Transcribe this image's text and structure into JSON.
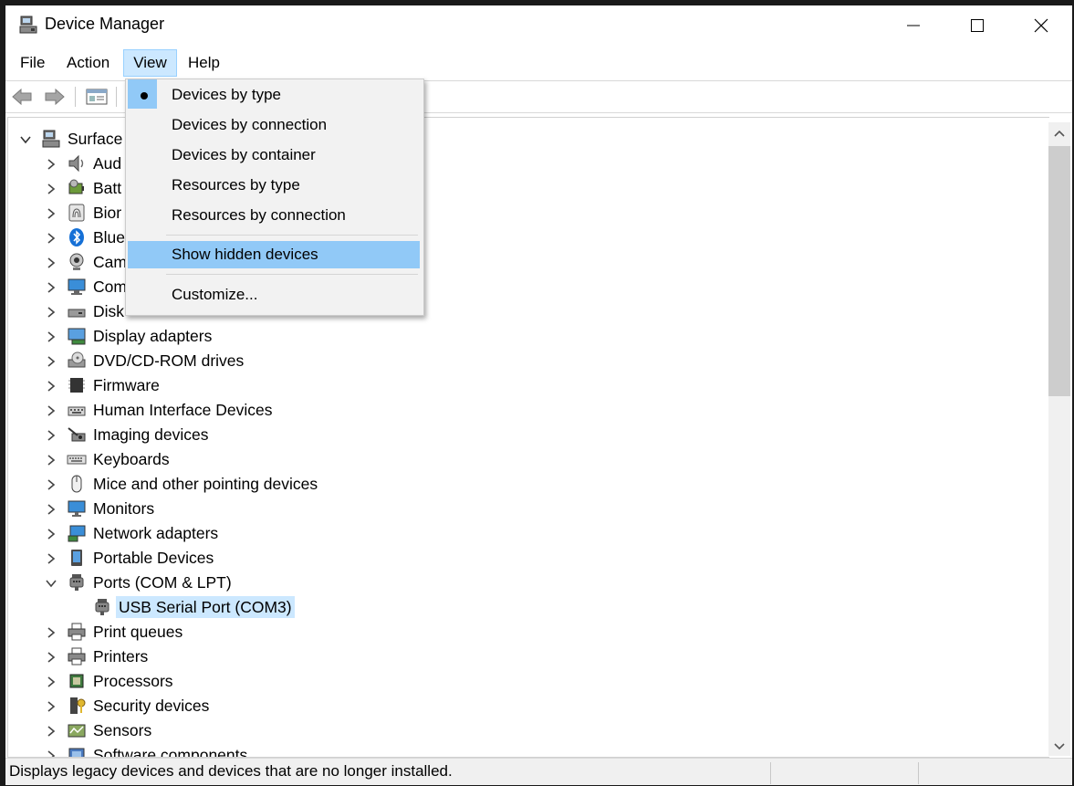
{
  "window": {
    "title": "Device Manager"
  },
  "menubar": {
    "items": [
      "File",
      "Action",
      "View",
      "Help"
    ]
  },
  "view_menu": {
    "items": [
      {
        "label": "Devices by type",
        "checked": true
      },
      {
        "label": "Devices by connection"
      },
      {
        "label": "Devices by container"
      },
      {
        "label": "Resources by type"
      },
      {
        "label": "Resources by connection"
      },
      {
        "label": "Show hidden devices",
        "highlighted": true
      },
      {
        "label": "Customize..."
      }
    ]
  },
  "tree": {
    "root": "Surface",
    "nodes": [
      {
        "label": "Aud",
        "icon": "speaker-icon"
      },
      {
        "label": "Batt",
        "icon": "battery-icon"
      },
      {
        "label": "Bior",
        "icon": "fingerprint-icon"
      },
      {
        "label": "Blue",
        "icon": "bluetooth-icon"
      },
      {
        "label": "Cam",
        "icon": "webcam-icon"
      },
      {
        "label": "Com",
        "icon": "computer-icon"
      },
      {
        "label": "Disk",
        "icon": "disk-drive-icon"
      },
      {
        "label": "Display adapters",
        "icon": "display-adapter-icon"
      },
      {
        "label": "DVD/CD-ROM drives",
        "icon": "dvd-drive-icon"
      },
      {
        "label": "Firmware",
        "icon": "firmware-chip-icon"
      },
      {
        "label": "Human Interface Devices",
        "icon": "hid-keyboard-icon"
      },
      {
        "label": "Imaging devices",
        "icon": "imaging-icon"
      },
      {
        "label": "Keyboards",
        "icon": "keyboard-icon"
      },
      {
        "label": "Mice and other pointing devices",
        "icon": "mouse-icon"
      },
      {
        "label": "Monitors",
        "icon": "monitor-icon"
      },
      {
        "label": "Network adapters",
        "icon": "network-adapter-icon"
      },
      {
        "label": "Portable Devices",
        "icon": "portable-device-icon"
      },
      {
        "label": "Ports (COM & LPT)",
        "icon": "port-connector-icon",
        "expanded": true
      },
      {
        "label": "USB Serial Port (COM3)",
        "icon": "port-connector-icon",
        "child": true,
        "selected": true
      },
      {
        "label": "Print queues",
        "icon": "printer-icon"
      },
      {
        "label": "Printers",
        "icon": "printer-icon"
      },
      {
        "label": "Processors",
        "icon": "processor-icon"
      },
      {
        "label": "Security devices",
        "icon": "security-key-icon"
      },
      {
        "label": "Sensors",
        "icon": "sensor-icon"
      },
      {
        "label": "Software components",
        "icon": "software-component-icon"
      }
    ]
  },
  "statusbar": {
    "text": "Displays legacy devices and devices that are no longer installed."
  },
  "colors": {
    "menu_highlight": "#91c9f7",
    "selection": "#cce8ff",
    "menu_bg": "#f2f2f2"
  }
}
